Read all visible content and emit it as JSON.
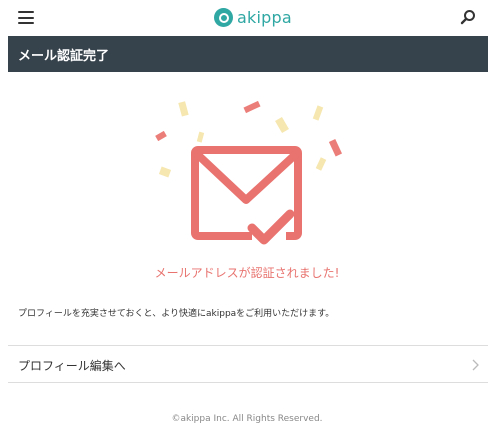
{
  "header": {
    "logo_text": "akippa",
    "menu_icon": "hamburger-menu-icon",
    "search_icon": "search-icon"
  },
  "page": {
    "title": "メール認証完了"
  },
  "illustration": {
    "icon": "envelope-check-icon",
    "color": "#e8736f",
    "confetti_colors": [
      "#f6e7b0",
      "#ec7e7a"
    ]
  },
  "message": {
    "success": "メールアドレスが認証されました!",
    "description": "プロフィールを充実させておくと、より快適にakippaをご利用いただけます。"
  },
  "profile_link": {
    "label": "プロフィール編集へ",
    "icon": "chevron-right-icon"
  },
  "footer": {
    "copyright": "©akippa Inc. All Rights Reserved."
  },
  "colors": {
    "header_bar": "#37434c",
    "brand": "#2fa7a3",
    "accent": "#e8736f"
  }
}
